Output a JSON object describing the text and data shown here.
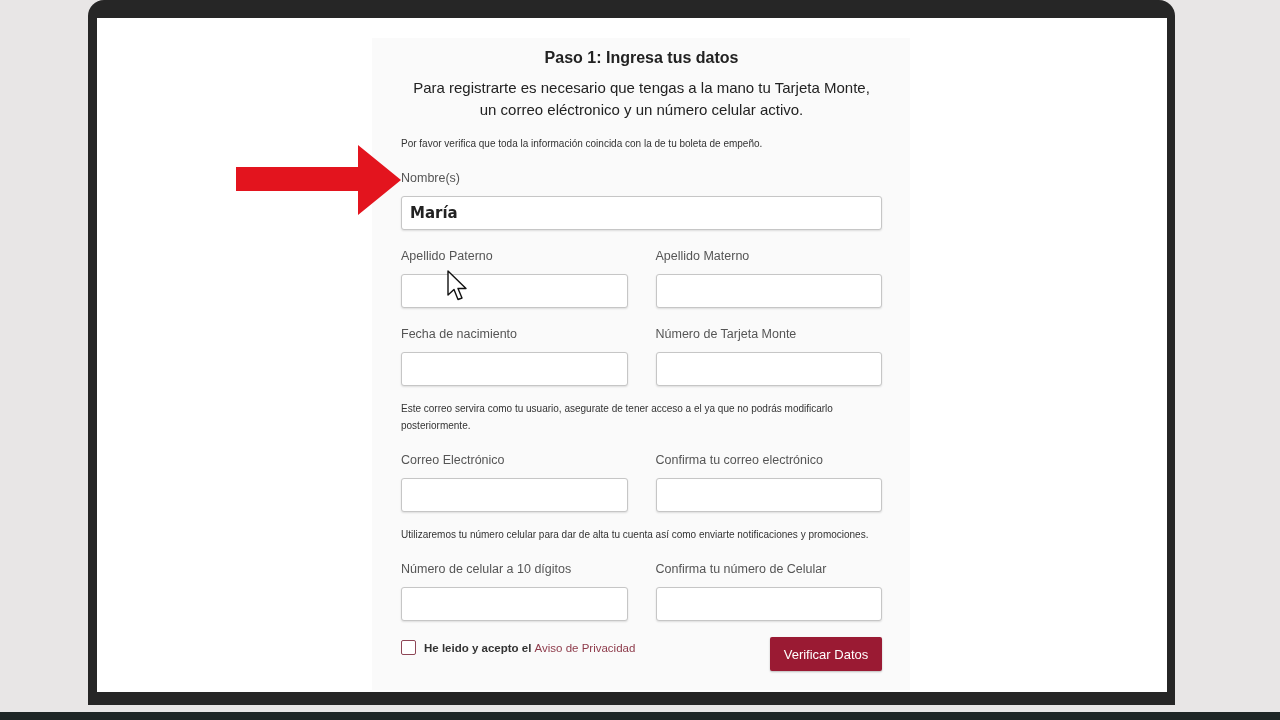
{
  "form": {
    "title": "Paso 1: Ingresa tus datos",
    "intro": "Para registrarte es necesario que tengas a la mano tu Tarjeta Monte,\nun correo eléctronico y un número celular activo.",
    "blocks": [
      {
        "kind": "note",
        "text": "Por favor verifica que toda la información coincida con la de tu boleta de empeño."
      },
      {
        "kind": "fields",
        "fields": [
          {
            "label": "Nombre(s)",
            "value": "María"
          }
        ]
      },
      {
        "kind": "fields",
        "fields": [
          {
            "label": "Apellido Paterno"
          },
          {
            "label": "Apellido Materno"
          }
        ]
      },
      {
        "kind": "fields",
        "fields": [
          {
            "label": "Fecha de nacimiento"
          },
          {
            "label": "Número de Tarjeta Monte"
          }
        ]
      },
      {
        "kind": "note",
        "text": "Este correo servira como tu usuario, asegurate de tener acceso a el ya que no podrás modificarlo posteriormente."
      },
      {
        "kind": "fields",
        "fields": [
          {
            "label": "Correo Electrónico"
          },
          {
            "label": "Confirma tu correo electrónico"
          }
        ]
      },
      {
        "kind": "note",
        "text": "Utilizaremos tu número celular para dar de alta tu cuenta así como enviarte notificaciones y promociones."
      },
      {
        "kind": "fields",
        "fields": [
          {
            "label": "Número de celular a 10 dígitos"
          },
          {
            "label": "Confirma tu número de Celular"
          }
        ]
      }
    ],
    "consent": {
      "checked": false,
      "text": "He leido y acepto el",
      "link": "Aviso de Privacidad"
    },
    "submit": "Verificar Datos"
  }
}
